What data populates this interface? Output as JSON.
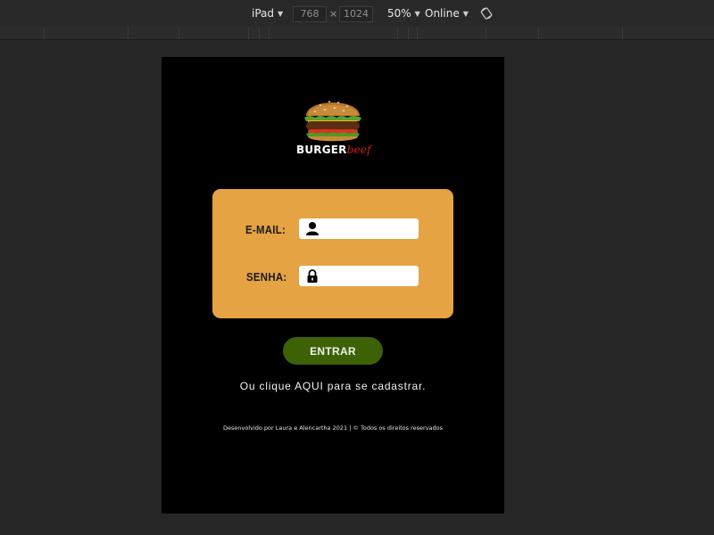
{
  "devtools": {
    "device": "iPad",
    "width": "768",
    "height": "1024",
    "times": "×",
    "zoom": "50%",
    "throttle": "Online",
    "rotate_icon": "rotate-icon"
  },
  "app": {
    "brand_main": "BURGER",
    "brand_sub": "beef",
    "email_label": "E-MAIL:",
    "password_label": "SENHA:",
    "email_value": "",
    "password_value": "",
    "enter_label": "ENTRAR",
    "register_text": "Ou clique AQUI para se cadastrar.",
    "footer_text": "Desenvolvido por Laura e Alencartha 2021 | © Todos os direitos reservados"
  },
  "colors": {
    "card": "#e5a343",
    "button": "#3d6206",
    "brand_accent": "#d11c1c",
    "background": "#000000"
  }
}
